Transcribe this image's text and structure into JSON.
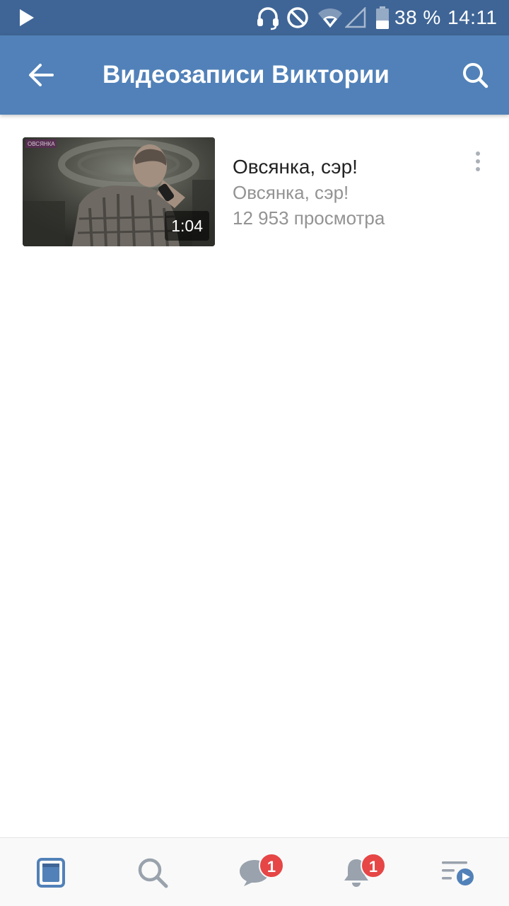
{
  "status_bar": {
    "battery_percent": "38 %",
    "time": "14:11",
    "icons": [
      "play-icon",
      "headset-icon",
      "do-not-disturb-icon",
      "wifi-icon",
      "signal-icon",
      "battery-icon"
    ]
  },
  "header": {
    "title": "Видеозаписи Виктории",
    "back_icon": "arrow-left-icon",
    "search_icon": "search-icon",
    "background_color": "#5181b8"
  },
  "videos": [
    {
      "title": "Овсянка, сэр!",
      "subtitle": "Овсянка, сэр!",
      "views": "12 953 просмотра",
      "duration": "1:04",
      "watermark": "ОВСЯНКА"
    }
  ],
  "bottom_nav": {
    "items": [
      {
        "icon": "news-icon",
        "active": true,
        "badge": null
      },
      {
        "icon": "search-icon",
        "active": false,
        "badge": null
      },
      {
        "icon": "messages-icon",
        "active": false,
        "badge": "1"
      },
      {
        "icon": "bell-icon",
        "active": false,
        "badge": "1"
      },
      {
        "icon": "video-playlist-icon",
        "active": false,
        "badge": null
      }
    ],
    "accent_color": "#5181b8",
    "inactive_color": "#99a2ad",
    "badge_color": "#e64646"
  }
}
